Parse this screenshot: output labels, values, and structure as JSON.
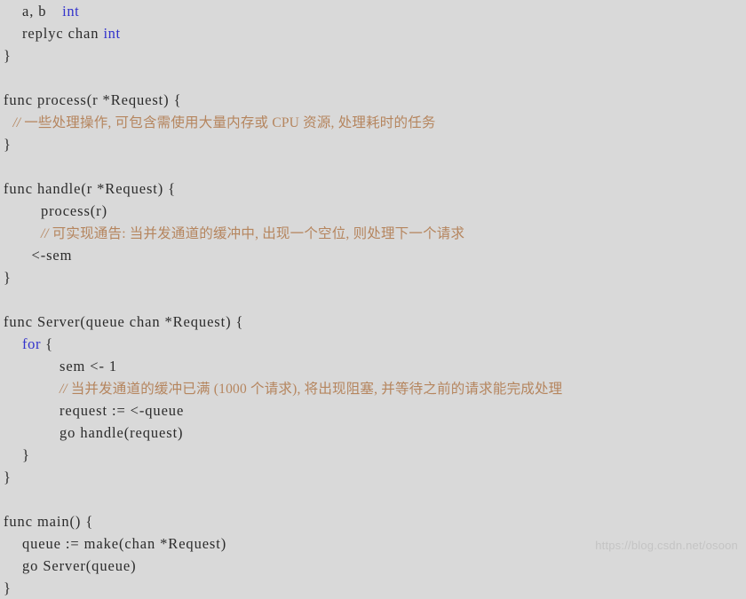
{
  "document": {
    "language": "go",
    "background_color": "#d9d9d9",
    "text_color": "#2b2b2b",
    "keyword_color": "#3333cc",
    "comment_color": "#b5855e"
  },
  "code": {
    "lines": [
      {
        "indent": 2,
        "segments": [
          {
            "type": "text",
            "value": "a, b"
          },
          {
            "type": "gap",
            "value": "    "
          },
          {
            "type": "keyword",
            "value": "int"
          }
        ]
      },
      {
        "indent": 2,
        "segments": [
          {
            "type": "text",
            "value": "replyc chan "
          },
          {
            "type": "keyword",
            "value": "int"
          }
        ]
      },
      {
        "indent": 0,
        "segments": [
          {
            "type": "text",
            "value": "}"
          }
        ]
      },
      {
        "indent": 0,
        "segments": []
      },
      {
        "indent": 0,
        "segments": [
          {
            "type": "text",
            "value": "func process(r *Request) {"
          }
        ]
      },
      {
        "indent": 1,
        "segments": [
          {
            "type": "comment",
            "value": "// 一些处理操作, 可包含需使用大量内存或 CPU 资源, 处理耗时的任务"
          }
        ]
      },
      {
        "indent": 0,
        "segments": [
          {
            "type": "text",
            "value": "}"
          }
        ]
      },
      {
        "indent": 0,
        "segments": []
      },
      {
        "indent": 0,
        "segments": [
          {
            "type": "text",
            "value": "func handle(r *Request) {"
          }
        ]
      },
      {
        "indent": 4,
        "segments": [
          {
            "type": "text",
            "value": "process(r)"
          }
        ]
      },
      {
        "indent": 4,
        "segments": [
          {
            "type": "comment",
            "value": "// 可实现通告: 当并发通道的缓冲中, 出现一个空位, 则处理下一个请求"
          }
        ]
      },
      {
        "indent": 3,
        "segments": [
          {
            "type": "text",
            "value": "<-sem"
          }
        ]
      },
      {
        "indent": 0,
        "segments": [
          {
            "type": "text",
            "value": "}"
          }
        ]
      },
      {
        "indent": 0,
        "segments": []
      },
      {
        "indent": 0,
        "segments": [
          {
            "type": "text",
            "value": "func Server(queue chan *Request) {"
          }
        ]
      },
      {
        "indent": 2,
        "segments": [
          {
            "type": "keyword",
            "value": "for"
          },
          {
            "type": "text",
            "value": " {"
          }
        ]
      },
      {
        "indent": 6,
        "segments": [
          {
            "type": "text",
            "value": "sem <- 1"
          }
        ]
      },
      {
        "indent": 6,
        "segments": [
          {
            "type": "comment",
            "value": "// 当并发通道的缓冲已满 (1000 个请求), 将出现阻塞, 并等待之前的请求能完成处理"
          }
        ]
      },
      {
        "indent": 6,
        "segments": [
          {
            "type": "text",
            "value": "request := <-queue"
          }
        ]
      },
      {
        "indent": 6,
        "segments": [
          {
            "type": "text",
            "value": "go handle(request)"
          }
        ]
      },
      {
        "indent": 2,
        "segments": [
          {
            "type": "text",
            "value": "}"
          }
        ]
      },
      {
        "indent": 0,
        "segments": [
          {
            "type": "text",
            "value": "}"
          }
        ]
      },
      {
        "indent": 0,
        "segments": []
      },
      {
        "indent": 0,
        "segments": [
          {
            "type": "text",
            "value": "func main() {"
          }
        ]
      },
      {
        "indent": 2,
        "segments": [
          {
            "type": "text",
            "value": "queue := make(chan *Request)"
          }
        ]
      },
      {
        "indent": 2,
        "segments": [
          {
            "type": "text",
            "value": "go Server(queue)"
          }
        ]
      },
      {
        "indent": 0,
        "segments": [
          {
            "type": "text",
            "value": "}"
          }
        ]
      }
    ]
  },
  "watermark": {
    "text": "https://blog.csdn.net/osoon"
  }
}
